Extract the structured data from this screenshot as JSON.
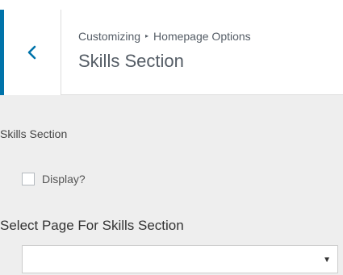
{
  "header": {
    "breadcrumb_parent": "Customizing",
    "breadcrumb_separator": "▸",
    "breadcrumb_current": "Homepage Options",
    "title": "Skills Section",
    "back_icon": "chevron-left-icon"
  },
  "section": {
    "label": "Skills Section",
    "display_checkbox_label": "Display?",
    "display_checked": false
  },
  "page_select": {
    "label": "Select Page For Skills Section",
    "selected_value": "",
    "arrow_icon": "▼"
  },
  "colors": {
    "accent": "#0073aa",
    "background": "#eeeeee",
    "header_background": "#ffffff"
  }
}
